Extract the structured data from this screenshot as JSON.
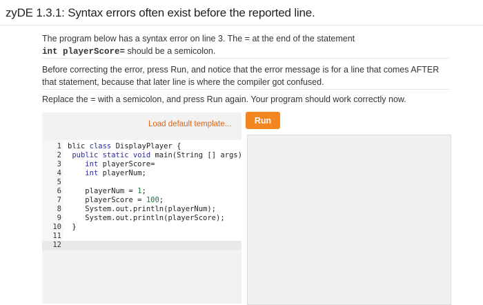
{
  "title": "zyDE 1.3.1: Syntax errors often exist before the reported line.",
  "intro": {
    "line1": "The program below has a syntax error on line 3. The = at the end of the statement",
    "code_ref": "int playerScore=",
    "line2_suffix": " should be a semicolon."
  },
  "para2": "Before correcting the error, press Run, and notice that the error message is for a line that comes AFTER that statement, because that later line is where the compiler got confused.",
  "para3": "Replace the = with a semicolon, and press Run again. Your program should work correctly now.",
  "load_template_label": "Load default template...",
  "run_label": "Run",
  "code_lines": [
    {
      "n": "1",
      "text": "blic class DisplayPlayer {"
    },
    {
      "n": "2",
      "text": " public static void main(String [] args) {"
    },
    {
      "n": "3",
      "text": "    int playerScore="
    },
    {
      "n": "4",
      "text": "    int playerNum;"
    },
    {
      "n": "5",
      "text": ""
    },
    {
      "n": "6",
      "text": "    playerNum = 1;"
    },
    {
      "n": "7",
      "text": "    playerScore = 100;"
    },
    {
      "n": "8",
      "text": "    System.out.println(playerNum);"
    },
    {
      "n": "9",
      "text": "    System.out.println(playerScore);"
    },
    {
      "n": "10",
      "text": " }"
    },
    {
      "n": "11",
      "text": ""
    },
    {
      "n": "12",
      "text": ""
    }
  ],
  "active_line": "12",
  "colors": {
    "accent": "#f4861f",
    "link": "#d8661c"
  }
}
